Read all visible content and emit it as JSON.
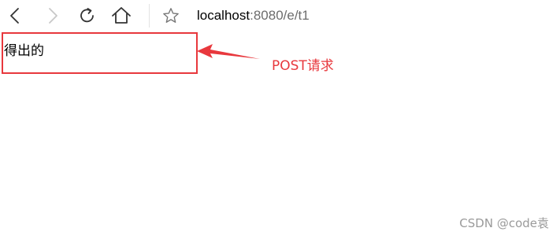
{
  "browser": {
    "address_host": "localhost",
    "address_rest": ":8080/e/t1",
    "icons": {
      "back": "back-icon",
      "forward": "forward-icon",
      "reload": "reload-icon",
      "home": "home-icon",
      "favorite": "star-icon"
    }
  },
  "page": {
    "body_text": "得出的"
  },
  "annotation": {
    "label": "POST请求",
    "color": "#e8383d"
  },
  "watermark": {
    "text": "CSDN @code袁"
  }
}
